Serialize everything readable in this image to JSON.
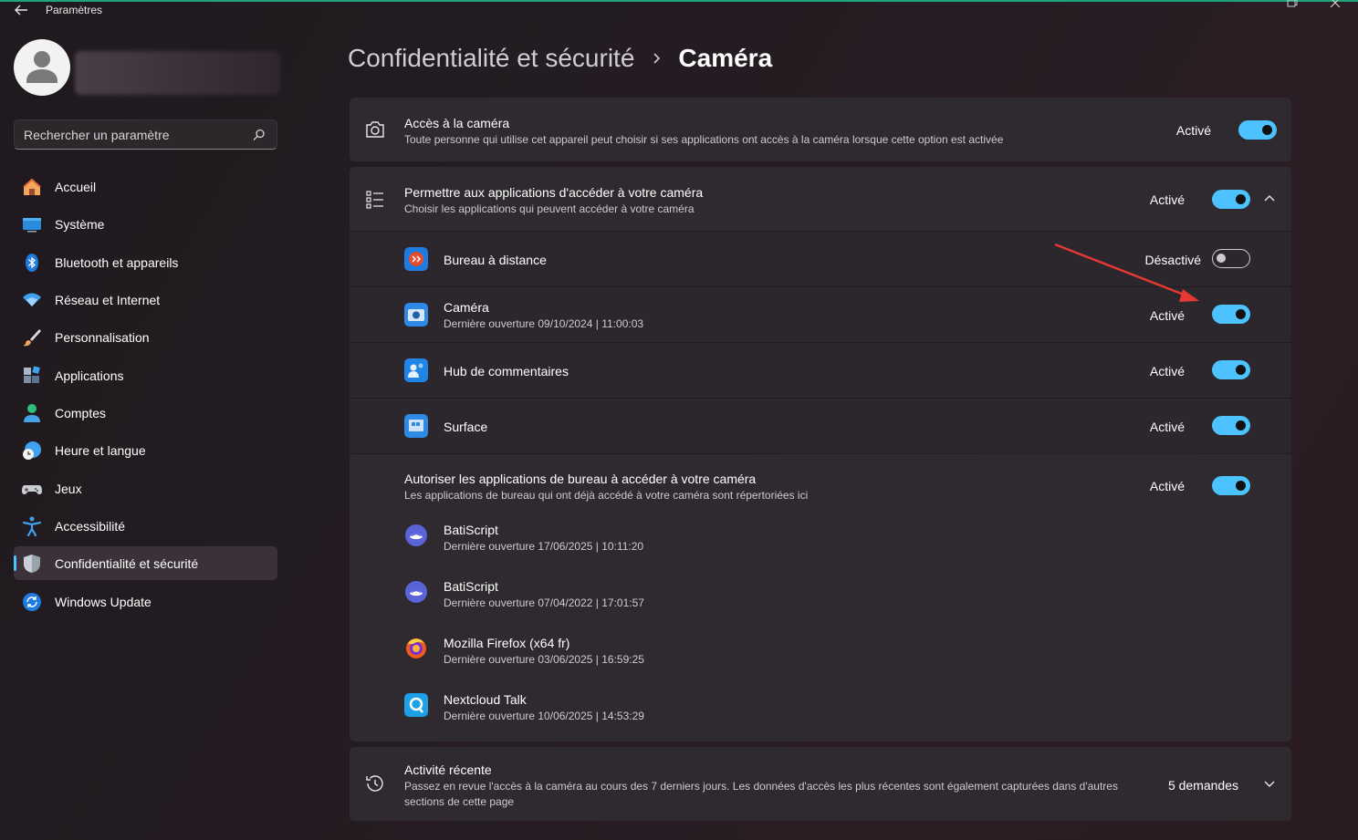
{
  "window": {
    "title": "Paramètres"
  },
  "user": {
    "avatar": "avatar-icon"
  },
  "search": {
    "placeholder": "Rechercher un paramètre",
    "icon": "search-icon"
  },
  "sidebar": {
    "items": [
      {
        "label": "Accueil",
        "icon": "home-icon"
      },
      {
        "label": "Système",
        "icon": "display-icon"
      },
      {
        "label": "Bluetooth et appareils",
        "icon": "bluetooth-icon"
      },
      {
        "label": "Réseau et Internet",
        "icon": "wifi-icon"
      },
      {
        "label": "Personnalisation",
        "icon": "brush-icon"
      },
      {
        "label": "Applications",
        "icon": "apps-icon"
      },
      {
        "label": "Comptes",
        "icon": "person-icon"
      },
      {
        "label": "Heure et langue",
        "icon": "globe-clock-icon"
      },
      {
        "label": "Jeux",
        "icon": "gamepad-icon"
      },
      {
        "label": "Accessibilité",
        "icon": "accessibility-icon"
      },
      {
        "label": "Confidentialité et sécurité",
        "icon": "shield-icon",
        "active": true
      },
      {
        "label": "Windows Update",
        "icon": "update-icon"
      }
    ]
  },
  "breadcrumb": {
    "parent": "Confidentialité et sécurité",
    "current": "Caméra"
  },
  "camera_access": {
    "title": "Accès à la caméra",
    "subtitle": "Toute personne qui utilise cet appareil peut choisir si ses applications ont accès à la caméra lorsque cette option est activée",
    "state": "Activé",
    "enabled": true
  },
  "apps_access": {
    "title": "Permettre aux applications d'accéder à votre caméra",
    "subtitle": "Choisir les applications qui peuvent accéder à votre caméra",
    "state": "Activé",
    "enabled": true,
    "apps": [
      {
        "name": "Bureau à distance",
        "subtitle": "",
        "state": "Désactivé",
        "enabled": false,
        "icon": "remote-desktop-icon"
      },
      {
        "name": "Caméra",
        "subtitle": "Dernière ouverture 09/10/2024  |  11:00:03",
        "state": "Activé",
        "enabled": true,
        "icon": "camera-app-icon"
      },
      {
        "name": "Hub de commentaires",
        "subtitle": "",
        "state": "Activé",
        "enabled": true,
        "icon": "feedback-hub-icon"
      },
      {
        "name": "Surface",
        "subtitle": "",
        "state": "Activé",
        "enabled": true,
        "icon": "surface-icon"
      }
    ]
  },
  "desktop_apps": {
    "title": "Autoriser les applications de bureau à accéder à votre caméra",
    "subtitle": "Les applications de bureau qui ont déjà accédé à votre caméra sont répertoriées ici",
    "state": "Activé",
    "enabled": true,
    "apps": [
      {
        "name": "BatiScript",
        "subtitle": "Dernière ouverture 17/06/2025  |  10:11:20",
        "icon": "batiscript-icon"
      },
      {
        "name": "BatiScript",
        "subtitle": "Dernière ouverture 07/04/2022  |  17:01:57",
        "icon": "batiscript-icon"
      },
      {
        "name": "Mozilla Firefox (x64 fr)",
        "subtitle": "Dernière ouverture 03/06/2025  |  16:59:25",
        "icon": "firefox-icon"
      },
      {
        "name": "Nextcloud Talk",
        "subtitle": "Dernière ouverture 10/06/2025  |  14:53:29",
        "icon": "nextcloud-talk-icon"
      }
    ]
  },
  "recent_activity": {
    "title": "Activité récente",
    "subtitle_line1": "Passez en revue l'accès à la caméra au cours des 7 derniers jours. Les données d'accès les plus récentes sont également capturées dans d'autres",
    "subtitle_line2": "sections de cette page",
    "count": "5 demandes"
  },
  "colors": {
    "accent": "#4cc2ff",
    "annotation_arrow": "#e53935",
    "active_indicator": "#4cc2ff"
  }
}
